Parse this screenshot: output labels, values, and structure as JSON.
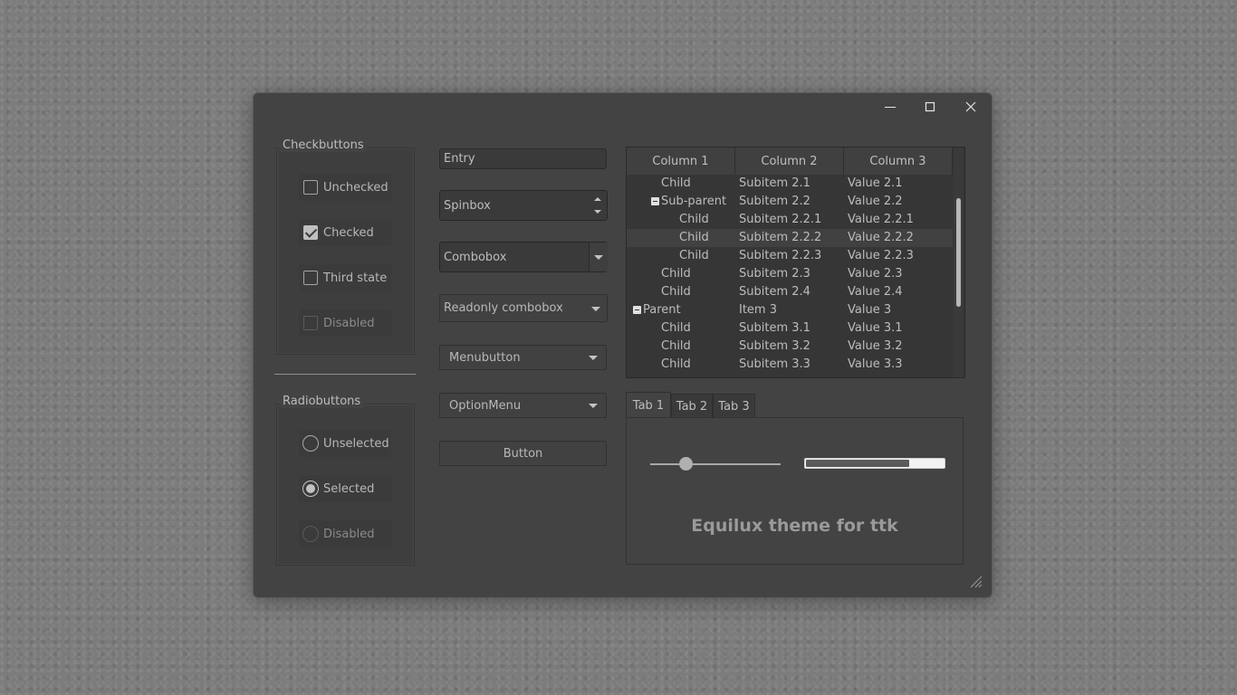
{
  "window": {
    "controls": {
      "minimize": "minimize-icon",
      "maximize": "maximize-icon",
      "close": "close-icon"
    }
  },
  "checkbuttons": {
    "title": "Checkbuttons",
    "items": [
      {
        "label": "Unchecked",
        "state": "unchecked"
      },
      {
        "label": "Checked",
        "state": "checked"
      },
      {
        "label": "Third state",
        "state": "unchecked"
      },
      {
        "label": "Disabled",
        "state": "disabled"
      }
    ]
  },
  "radiobuttons": {
    "title": "Radiobuttons",
    "items": [
      {
        "label": "Unselected",
        "state": "unselected"
      },
      {
        "label": "Selected",
        "state": "selected"
      },
      {
        "label": "Disabled",
        "state": "disabled"
      }
    ]
  },
  "widgets": {
    "entry": "Entry",
    "spinbox": "Spinbox",
    "combobox": "Combobox",
    "readonly_combobox": "Readonly combobox",
    "menubutton": "Menubutton",
    "optionmenu": "OptionMenu",
    "button": "Button"
  },
  "tree": {
    "columns": [
      "Column 1",
      "Column 2",
      "Column 3"
    ],
    "rows": [
      {
        "c1": "Child",
        "c2": "Subitem 2.1",
        "c3": "Value 2.1"
      },
      {
        "c1": "Sub-parent",
        "c2": "Subitem 2.2",
        "c3": "Value 2.2"
      },
      {
        "c1": "Child",
        "c2": "Subitem 2.2.1",
        "c3": "Value 2.2.1"
      },
      {
        "c1": "Child",
        "c2": "Subitem 2.2.2",
        "c3": "Value 2.2.2"
      },
      {
        "c1": "Child",
        "c2": "Subitem 2.2.3",
        "c3": "Value 2.2.3"
      },
      {
        "c1": "Child",
        "c2": "Subitem 2.3",
        "c3": "Value 2.3"
      },
      {
        "c1": "Child",
        "c2": "Subitem 2.4",
        "c3": "Value 2.4"
      },
      {
        "c1": "Parent",
        "c2": "Item 3",
        "c3": "Value 3"
      },
      {
        "c1": "Child",
        "c2": "Subitem 3.1",
        "c3": "Value 3.1"
      },
      {
        "c1": "Child",
        "c2": "Subitem 3.2",
        "c3": "Value 3.2"
      },
      {
        "c1": "Child",
        "c2": "Subitem 3.3",
        "c3": "Value 3.3"
      }
    ]
  },
  "notebook": {
    "tabs": [
      "Tab 1",
      "Tab 2",
      "Tab 3"
    ],
    "active_tab": "Tab 1",
    "scale_value": 0.27,
    "progress_value": 0.75,
    "caption": "Equilux theme for ttk"
  }
}
